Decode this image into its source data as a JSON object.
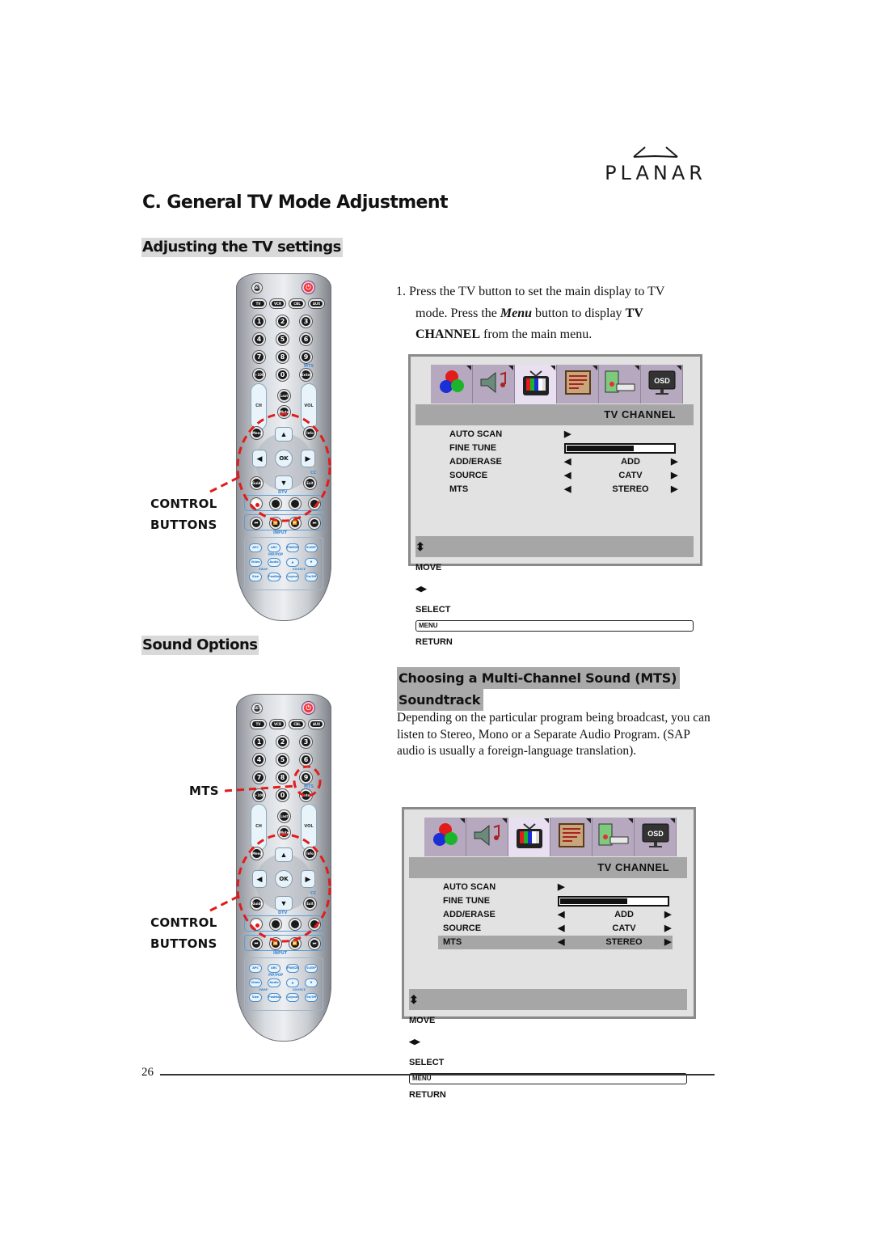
{
  "brand": {
    "name": "PLANAR"
  },
  "page": {
    "title": "C. General TV Mode Adjustment",
    "number": "26"
  },
  "section1": {
    "heading": "Adjusting the TV settings",
    "step": {
      "num": "1.",
      "text_a": "Press the TV button to set the main display to TV",
      "text_b_pre": "mode. Press the ",
      "text_b_menu": "Menu",
      "text_b_mid": " button to display ",
      "text_b_bold": "TV",
      "text_c_bold": "CHANNEL",
      "text_c_post": " from the main menu."
    },
    "callout": {
      "line1": "CONTROL",
      "line2": "BUTTONS"
    }
  },
  "section2": {
    "heading": "Sound Options",
    "subheading_line1": "Choosing a Multi-Channel Sound (MTS)",
    "subheading_line2": "Soundtrack",
    "body": "Depending on the particular program being broadcast, you can listen to Stereo, Mono or a Separate Audio Program. (SAP audio is usually a foreign-language translation).",
    "callout_mts": "MTS",
    "callout": {
      "line1": "CONTROL",
      "line2": "BUTTONS"
    }
  },
  "remote": {
    "top": {
      "set": "SET",
      "power": "⏻"
    },
    "modes": [
      "TV",
      "VCR",
      "CBL",
      "AUX"
    ],
    "digits": [
      "1",
      "2",
      "3",
      "4",
      "5",
      "6",
      "7",
      "8",
      "9",
      "+100",
      "0",
      "Enter"
    ],
    "mts_label": "MTS",
    "ch": "CH",
    "vol": "VOL",
    "last": "Last",
    "mute": "Mute",
    "menu": "Menu",
    "info": "Info",
    "ok": "OK",
    "guide": "Guide",
    "exit": "Exit",
    "cc": "CC",
    "dtv": "DTV",
    "input": "INPUT",
    "pip": "PIP/POP",
    "swap": "SWAP",
    "source": "SOURCE",
    "bottom": [
      "APC",
      "ARC",
      "FREEZE",
      "SLEEP",
      "Video",
      "Audio",
      "▲",
      "▼",
      "Size",
      "Position",
      "Layout",
      "On/Off"
    ]
  },
  "osd": {
    "tabs": [
      "color-icon",
      "audio-icon",
      "tv-icon",
      "setup-icon",
      "pc-icon",
      "osd-icon"
    ],
    "active_tab": 2,
    "osd_tab_label": "OSD",
    "title": "TV  CHANNEL",
    "rows": [
      {
        "key": "AUTO SCAN",
        "value": "",
        "type": "action"
      },
      {
        "key": "FINE TUNE",
        "value": "",
        "type": "slider"
      },
      {
        "key": "ADD/ERASE",
        "value": "ADD",
        "type": "select"
      },
      {
        "key": "SOURCE",
        "value": "CATV",
        "type": "select"
      },
      {
        "key": "MTS",
        "value": "STEREO",
        "type": "select"
      }
    ],
    "fine_tune_level": 0.62,
    "footer": {
      "move": "MOVE",
      "select": "SELECT",
      "menu_key": "MENU",
      "return": "RETURN"
    },
    "arrow_left": "◀",
    "arrow_right": "▶",
    "updown": "⬍",
    "leftright": "◀▶"
  },
  "colors": {
    "callout_dash": "#e21b1b",
    "osd_bg": "#e2e2e2",
    "osd_bar": "#a6a6a6",
    "osd_tab": "#b6a8bf"
  }
}
